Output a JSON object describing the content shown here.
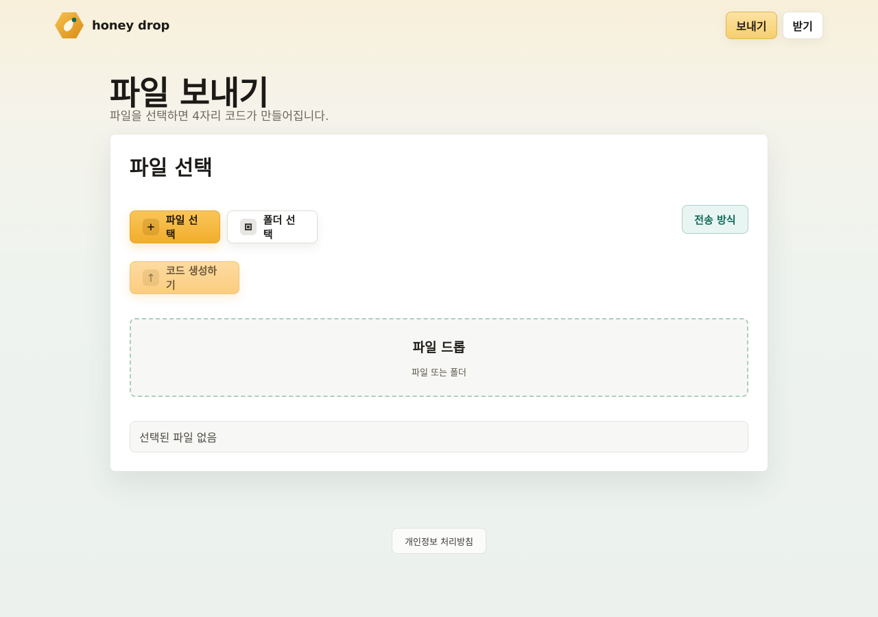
{
  "app": {
    "brand_name": "honey drop",
    "logo_icon": "honey-drop-hexagon-logo"
  },
  "nav": {
    "send_label": "보내기",
    "receive_label": "받기",
    "active": "send"
  },
  "page": {
    "title": "파일 보내기",
    "subtitle": "파일을 선택하면 4자리 코드가 만들어집니다."
  },
  "card": {
    "title": "파일 선택",
    "file_button": {
      "label": "파일 선택",
      "icon": "plus-icon",
      "glyph": "+"
    },
    "folder_button": {
      "label": "폴더 선택",
      "icon": "folder-icon"
    },
    "mode_button": {
      "label": "전송 방식"
    },
    "generate_button": {
      "label": "코드 생성하기",
      "icon": "upload-arrow-icon",
      "glyph": "↑",
      "state": "disabled"
    },
    "dropzone": {
      "title": "파일 드롭",
      "hint": "파일 또는 폴더"
    },
    "selected_text": "선택된 파일 없음"
  },
  "footer": {
    "privacy_label": "개인정보 처리방침"
  },
  "colors": {
    "accent": "#f1ad2c",
    "accent_light": "#fbcd80",
    "teal": "#0f6a59",
    "teal_bg": "#e9f5f2",
    "dropzone_border": "#a9cfc1",
    "text": "#1c1a17",
    "muted": "#6f675c"
  }
}
